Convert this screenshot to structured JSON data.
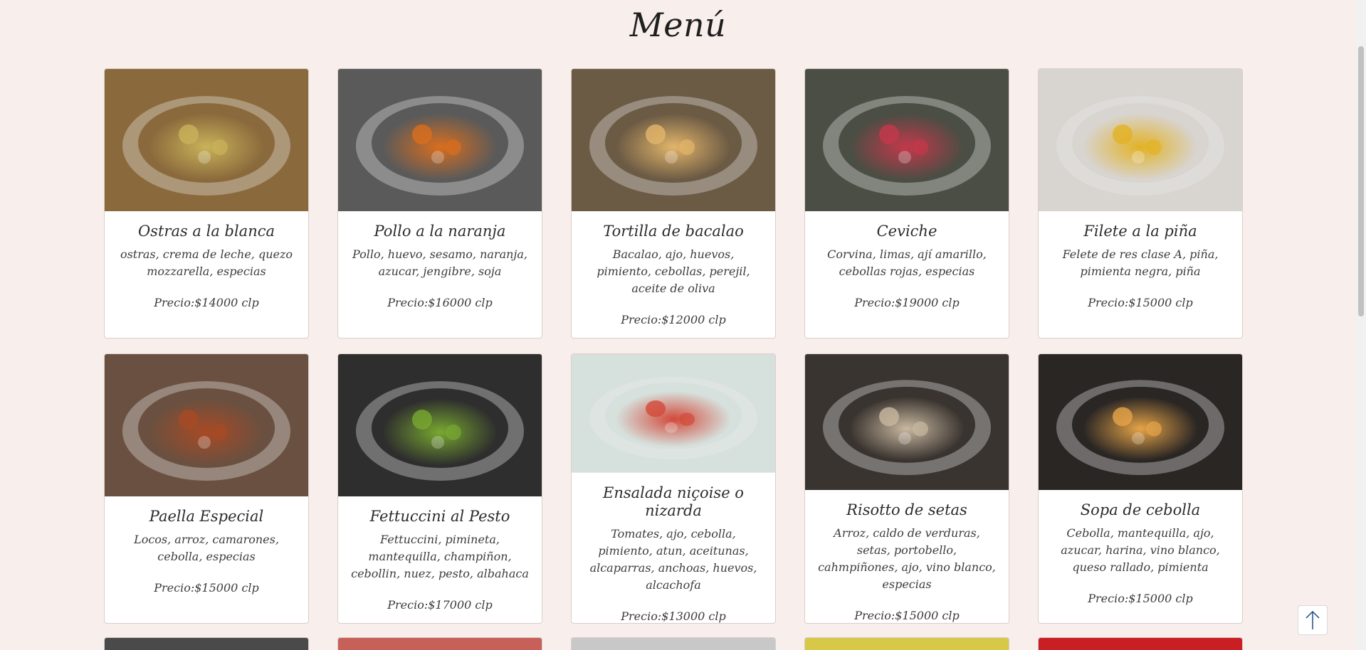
{
  "page": {
    "title": "Menú"
  },
  "dishes": [
    {
      "name": "Ostras a la blanca",
      "description": "ostras, crema de leche, quezo mozzarella, especias",
      "price": "Precio:$14000 clp",
      "photo": "oysters-photo"
    },
    {
      "name": "Pollo a la naranja",
      "description": "Pollo, huevo, sesamo, naranja, azucar, jengibre, soja",
      "price": "Precio:$16000 clp",
      "photo": "orange-chicken-photo"
    },
    {
      "name": "Tortilla de bacalao",
      "description": "Bacalao, ajo, huevos, pimiento, cebollas, perejil, aceite de oliva",
      "price": "Precio:$12000 clp",
      "photo": "tortilla-photo"
    },
    {
      "name": "Ceviche",
      "description": "Corvina, limas, ají amarillo, cebollas rojas, especias",
      "price": "Precio:$19000 clp",
      "photo": "ceviche-photo"
    },
    {
      "name": "Filete a la piña",
      "description": "Felete de res clase A, piña, pimienta negra, piña",
      "price": "Precio:$15000 clp",
      "photo": "steak-photo"
    },
    {
      "name": "Paella Especial",
      "description": "Locos, arroz, camarones, cebolla, especias",
      "price": "Precio:$15000 clp",
      "photo": "paella-photo"
    },
    {
      "name": "Fettuccini al Pesto",
      "description": "Fettuccini, pimineta, mantequilla, champiñon, cebollin, nuez, pesto, albahaca",
      "price": "Precio:$17000 clp",
      "photo": "pesto-photo"
    },
    {
      "name": "Ensalada niçoise o nizarda",
      "description": "Tomates, ajo, cebolla, pimiento, atun, aceitunas, alcaparras, anchoas, huevos, alcachofa",
      "price": "Precio:$13000 clp",
      "photo": "salad-photo"
    },
    {
      "name": "Risotto de setas",
      "description": "Arroz, caldo de verduras, setas, portobello, cahmpiñones, ajo, vino blanco, especias",
      "price": "Precio:$15000 clp",
      "photo": "risotto-photo"
    },
    {
      "name": "Sopa de cebolla",
      "description": "Cebolla, mantequilla, ajo, azucar, harina, vino blanco, queso rallado, pimienta",
      "price": "Precio:$15000 clp",
      "photo": "onion-soup-photo"
    }
  ],
  "photo_backgrounds": [
    "#8a6a3c",
    "#5a5a5a",
    "#6b5a44",
    "#4a4e44",
    "#d8d4d0",
    "#6a5040",
    "#2e2e2e",
    "#d6e0dc",
    "#3a3430",
    "#2a2624"
  ],
  "photo_accents": [
    "#c9b25a",
    "#d96e1e",
    "#e2b56a",
    "#c4384a",
    "#e2b224",
    "#a84a24",
    "#78a830",
    "#d24a3a",
    "#c8b8a0",
    "#e6a448"
  ],
  "peek_colors": [
    "#4a4a4a",
    "#c8605a",
    "#c8c8c8",
    "#d8c848",
    "#c81e24"
  ],
  "icons": {
    "back_to_top": "arrow-up-icon"
  }
}
